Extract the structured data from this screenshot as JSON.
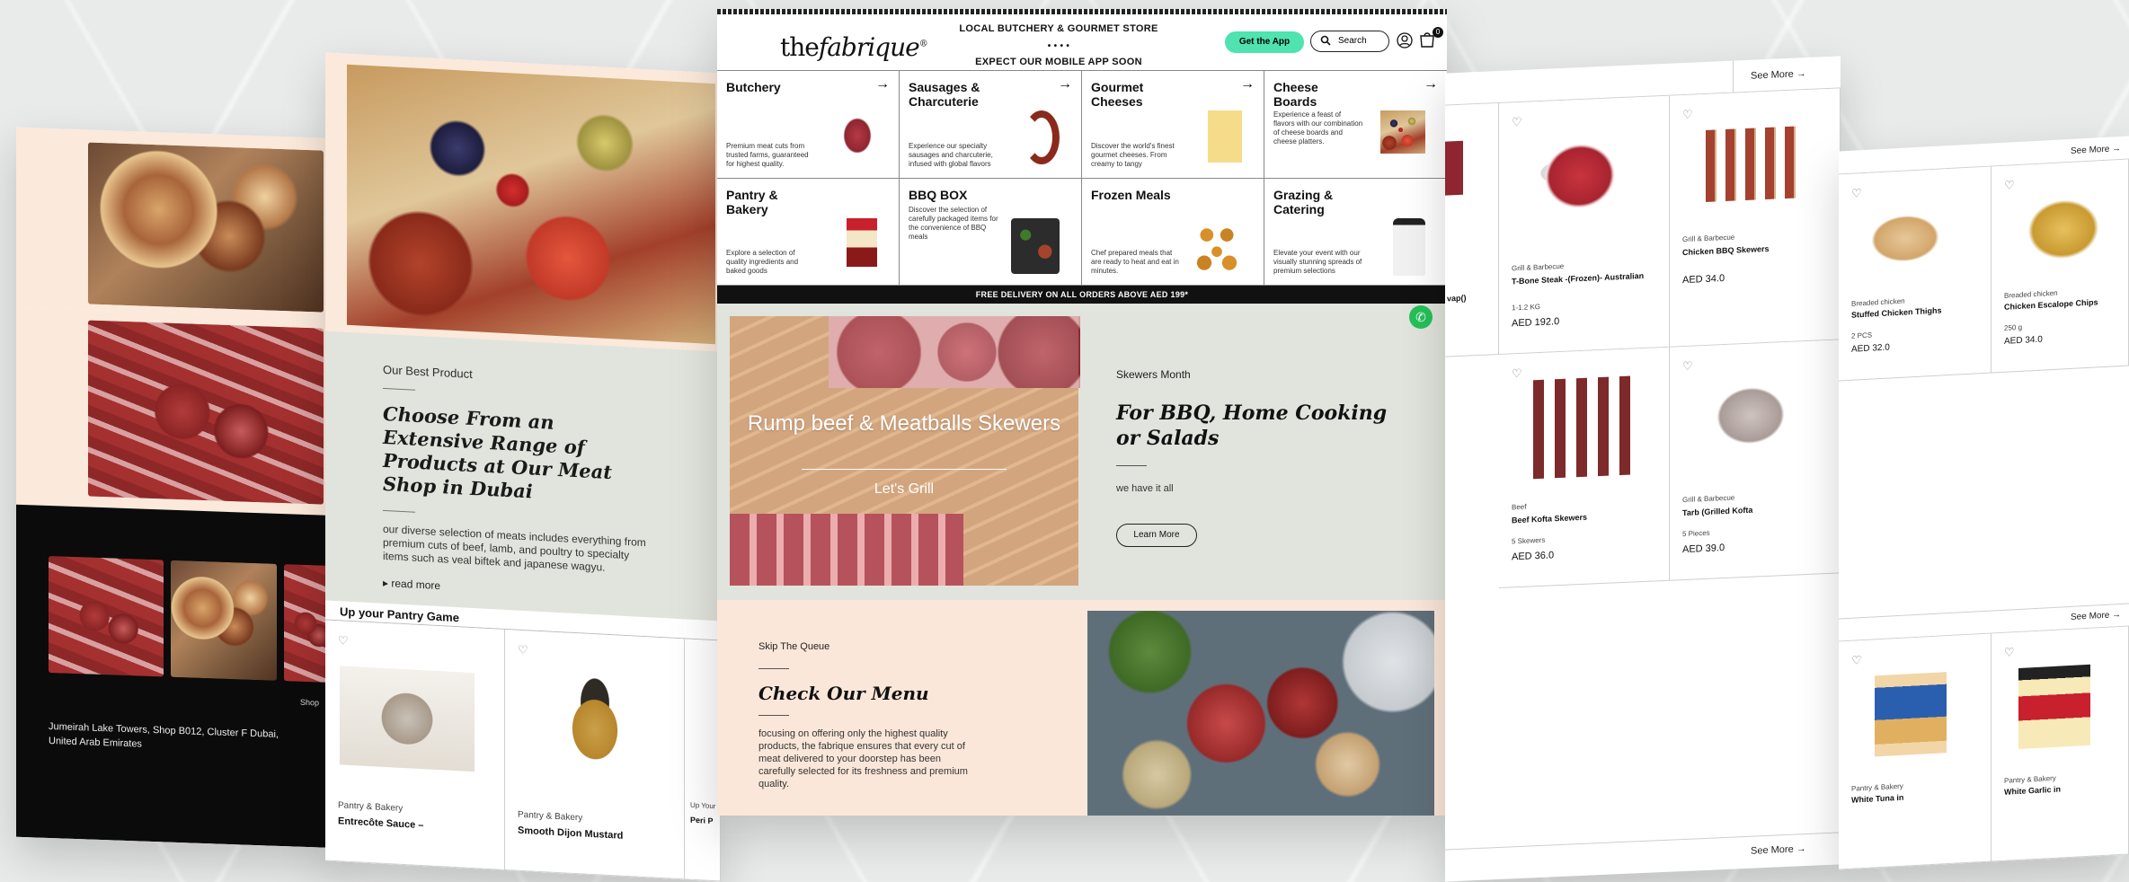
{
  "colors": {
    "accent_green": "#4fe3b0",
    "sage": "#e0e4dc",
    "peach": "#fbe7d9",
    "black": "#111111",
    "whatsapp": "#25c05a"
  },
  "far_left": {
    "address": "Jumeirah Lake Towers, Shop B012, Cluster F Dubai, United Arab Emirates",
    "shop_label": "Shop"
  },
  "left": {
    "tag": "Our Best Product",
    "heading": "Choose From an Extensive Range of Products at Our Meat Shop in Dubai",
    "body": "our diverse selection of meats includes everything from premium cuts of beef, lamb, and poultry to specialty items such as veal biftek and japanese wagyu.",
    "read_more": "read more",
    "pantry_title": "Up your Pantry Game",
    "products": [
      {
        "cat": "Pantry & Bakery",
        "name": "Entrecôte Sauce –"
      },
      {
        "cat": "Pantry & Bakery",
        "name": "Smooth Dijon Mustard"
      },
      {
        "cat": "Up Your",
        "name": "Peri P"
      }
    ]
  },
  "header": {
    "logo_the": "the",
    "logo_fab": "fabrique",
    "line1": "LOCAL BUTCHERY & GOURMET STORE",
    "dots": "• • • •",
    "line2": "EXPECT OUR MOBILE APP SOON",
    "get_app": "Get the App",
    "search": "Search",
    "cart_count": "0"
  },
  "categories": [
    {
      "title": "Butchery",
      "desc": "Premium meat cuts from trusted farms, guaranteed for highest quality."
    },
    {
      "title": "Sausages & Charcuterie",
      "desc": "Experience our specialty sausages and charcuterie, infused with global flavors"
    },
    {
      "title": "Gourmet Cheeses",
      "desc": "Discover the world's finest gourmet cheeses. From creamy to tangy"
    },
    {
      "title": "Cheese Boards",
      "desc": "Experience a feast of flavors with our combination of cheese boards and cheese platters."
    },
    {
      "title": "Pantry & Bakery",
      "desc": "Explore a selection of quality ingredients and baked goods"
    },
    {
      "title": "BBQ BOX",
      "desc": "Discover the selection of carefully packaged items for the convenience of BBQ meals"
    },
    {
      "title": "Frozen Meals",
      "desc": "Chef prepared meals that are ready to heat and eat in minutes."
    },
    {
      "title": "Grazing & Catering",
      "desc": "Elevate your event with our visually stunning spreads of premium selections"
    }
  ],
  "free_delivery": "FREE DELIVERY ON ALL ORDERS ABOVE AED 199*",
  "promo": {
    "title": "Rump beef & Meatballs Skewers",
    "sub": "Let's Grill"
  },
  "skewers": {
    "tag": "Skewers Month",
    "heading": "For BBQ, Home Cooking or Salads",
    "body": "we have it all",
    "button": "Learn More"
  },
  "menu": {
    "tag": "Skip The Queue",
    "heading": "Check Our Menu",
    "body": "focusing on offering only the highest quality products, the fabrique ensures that every cut of meat delivered to your doorstep has been carefully selected for its freshness and premium quality."
  },
  "right": {
    "see_more": "See More",
    "partial": "vap()",
    "products": [
      {
        "cat": "Grill & Barbecue",
        "name": "T-Bone Steak -(Frozen)- Australian",
        "qty": "1-1.2 KG",
        "price": "AED 192.0"
      },
      {
        "cat": "Grill & Barbecue",
        "name": "Chicken BBQ Skewers",
        "qty": "",
        "price": "AED 34.0"
      },
      {
        "cat": "Beef",
        "name": "Beef Kofta Skewers",
        "qty": "5 Skewers",
        "price": "AED 36.0"
      },
      {
        "cat": "Grill & Barbecue",
        "name": "Tarb (Grilled Kofta",
        "qty": "5 Pieces",
        "price": "AED 39.0"
      }
    ]
  },
  "far_right": {
    "see_more": "See More",
    "products": [
      {
        "cat": "Breaded chicken",
        "name": "Stuffed Chicken Thighs",
        "qty": "2 PCS",
        "price": "AED 32.0"
      },
      {
        "cat": "Breaded chicken",
        "name": "Chicken Escalope Chips",
        "qty": "250 g",
        "price": "AED 34.0"
      },
      {
        "cat": "Pantry & Bakery",
        "name": "White Tuna in",
        "qty": "",
        "price": ""
      },
      {
        "cat": "Pantry & Bakery",
        "name": "White Garlic in",
        "qty": "",
        "price": ""
      }
    ]
  }
}
